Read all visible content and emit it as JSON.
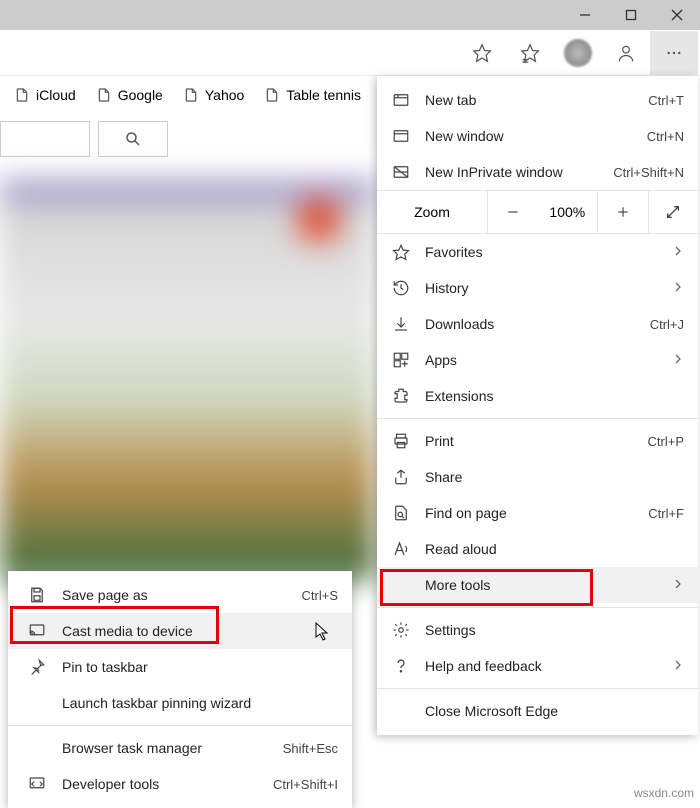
{
  "titlebar": {},
  "bookmarks": [
    {
      "label": "iCloud"
    },
    {
      "label": "Google"
    },
    {
      "label": "Yahoo"
    },
    {
      "label": "Table tennis"
    }
  ],
  "menu": {
    "new_tab": {
      "label": "New tab",
      "shortcut": "Ctrl+T"
    },
    "new_window": {
      "label": "New window",
      "shortcut": "Ctrl+N"
    },
    "new_inprivate": {
      "label": "New InPrivate window",
      "shortcut": "Ctrl+Shift+N"
    },
    "zoom": {
      "label": "Zoom",
      "value": "100%"
    },
    "favorites": {
      "label": "Favorites"
    },
    "history": {
      "label": "History"
    },
    "downloads": {
      "label": "Downloads",
      "shortcut": "Ctrl+J"
    },
    "apps": {
      "label": "Apps"
    },
    "extensions": {
      "label": "Extensions"
    },
    "print": {
      "label": "Print",
      "shortcut": "Ctrl+P"
    },
    "share": {
      "label": "Share"
    },
    "find": {
      "label": "Find on page",
      "shortcut": "Ctrl+F"
    },
    "read_aloud": {
      "label": "Read aloud"
    },
    "more_tools": {
      "label": "More tools"
    },
    "settings": {
      "label": "Settings"
    },
    "help": {
      "label": "Help and feedback"
    },
    "close": {
      "label": "Close Microsoft Edge"
    }
  },
  "submenu": {
    "save_as": {
      "label": "Save page as",
      "shortcut": "Ctrl+S"
    },
    "cast": {
      "label": "Cast media to device"
    },
    "pin": {
      "label": "Pin to taskbar"
    },
    "launch_pin": {
      "label": "Launch taskbar pinning wizard"
    },
    "task_manager": {
      "label": "Browser task manager",
      "shortcut": "Shift+Esc"
    },
    "dev_tools": {
      "label": "Developer tools",
      "shortcut": "Ctrl+Shift+I"
    }
  },
  "watermark": "wsxdn.com"
}
